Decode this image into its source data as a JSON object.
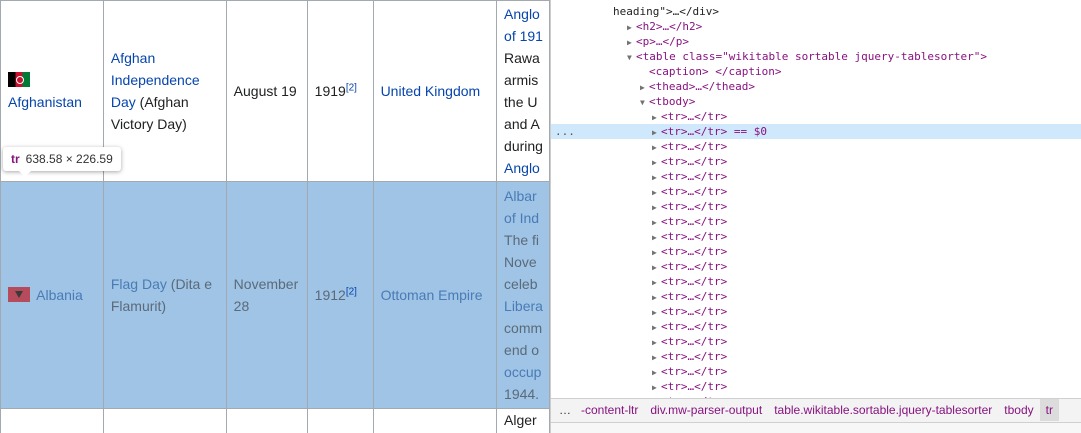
{
  "table": {
    "rows": [
      {
        "country": "Afghanistan",
        "name_link": "Afghan Independence Day",
        "name_extra": "(Afghan Victory Day)",
        "date": "August 19",
        "year": "1919",
        "ref": "[2]",
        "from": "United Kingdom",
        "desc_lines": [
          "Anglo",
          "of 191",
          "Rawa",
          "armis",
          "the U",
          "and A",
          "during",
          "Anglo"
        ]
      },
      {
        "country": "Albania",
        "name_link": "Flag Day",
        "name_extra": "(Dita e Flamurit)",
        "date": "November 28",
        "year": "1912",
        "ref": "[2]",
        "from": "Ottoman Empire",
        "desc_lines": [
          "Albar",
          "of Ind",
          "The fi",
          "Nove",
          "celeb",
          "Libera",
          "comm",
          "end o",
          "occup",
          "1944."
        ]
      },
      {
        "desc_lines": [
          "Alger"
        ]
      }
    ]
  },
  "tooltip": {
    "tag": "tr",
    "size": "638.58 × 226.59"
  },
  "devtools": {
    "lines": [
      "heading\">…</div>",
      "<h2>…</h2>",
      "<p>…</p>",
      "<table class=\"wikitable sortable jquery-tablesorter\">",
      "<caption> </caption>",
      "<thead>…</thead>",
      "<tbody>",
      "<tr>…</tr>",
      "<tr>…</tr> == $0",
      "<tr>…</tr>"
    ],
    "selected_marker": "== $0",
    "gutter": "...",
    "breadcrumb": [
      "…",
      "-content-ltr",
      "div.mw-parser-output",
      "table.wikitable.sortable.jquery-tablesorter",
      "tbody",
      "tr"
    ]
  },
  "colors": {
    "link": "#0645ad",
    "highlight": "#9fc4e5",
    "selected_line": "#cfe8fc",
    "tag": "#881280"
  }
}
